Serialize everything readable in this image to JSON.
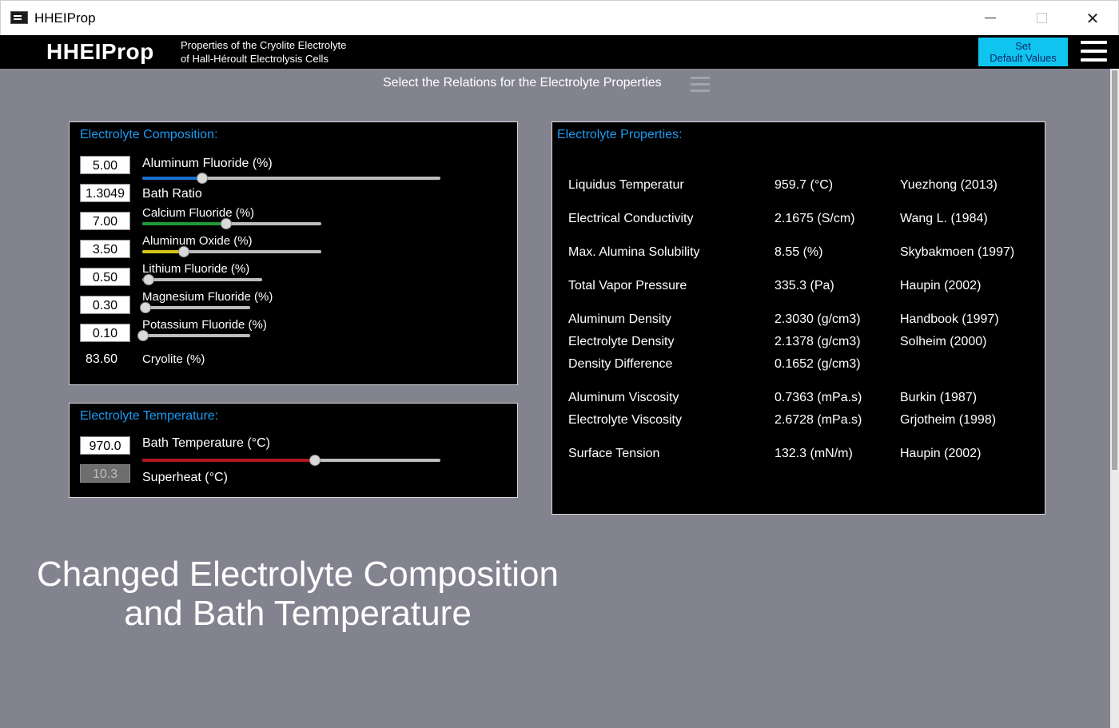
{
  "window": {
    "title": "HHEIProp"
  },
  "appbar": {
    "name": "HHEIProp",
    "subtitle_line1": "Properties of the Cryolite Electrolyte",
    "subtitle_line2": "of Hall-Héroult Electrolysis Cells",
    "default_btn_line1": "Set",
    "default_btn_line2": "Default Values"
  },
  "relations": {
    "label": "Select the Relations for the Electrolyte Properties"
  },
  "composition": {
    "title": "Electrolyte Composition:",
    "rows": [
      {
        "value": "5.00",
        "label": "Aluminum Fluoride (%)",
        "level": 0.2
      },
      {
        "value": "1.3049",
        "label": "Bath Ratio"
      },
      {
        "value": "7.00",
        "label": "Calcium Fluoride (%)",
        "level": 0.47
      },
      {
        "value": "3.50",
        "label": "Aluminum Oxide (%)",
        "level": 0.23
      },
      {
        "value": "0.50",
        "label": "Lithium Fluoride (%)",
        "level": 0.05
      },
      {
        "value": "0.30",
        "label": "Magnesium Fluoride (%)",
        "level": 0.03
      },
      {
        "value": "0.10",
        "label": "Potassium Fluoride (%)",
        "level": 0.01
      },
      {
        "value": "83.60",
        "label": "Cryolite (%)"
      }
    ],
    "colors": {
      "alf3": "#1a6fd1",
      "caf2": "#1f9a3a",
      "al2o3": "#d6c51c"
    }
  },
  "temperature": {
    "title": "Electrolyte Temperature:",
    "bath_value": "970.0",
    "bath_label": "Bath Temperature (°C)",
    "bath_level": 0.58,
    "superheat_value": "10.3",
    "superheat_label": "Superheat (°C)",
    "color": "#b0161b"
  },
  "properties": {
    "title": "Electrolyte Properties:",
    "rows": [
      {
        "name": "Liquidus Temperatur",
        "value": "959.7  (°C)",
        "ref": "Yuezhong (2013)"
      },
      {
        "name": "Electrical Conductivity",
        "value": "2.1675 (S/cm)",
        "ref": "Wang L. (1984)"
      },
      {
        "name": "Max. Alumina Solubility",
        "value": "8.55  (%)",
        "ref": "Skybakmoen (1997)"
      },
      {
        "name": "Total Vapor Pressure",
        "value": "335.3  (Pa)",
        "ref": "Haupin (2002)"
      },
      {
        "name": "Aluminum Density",
        "value": "2.3030 (g/cm3)",
        "ref": "Handbook (1997)"
      },
      {
        "name": "Electrolyte Density",
        "value": "2.1378 (g/cm3)",
        "ref": "Solheim (2000)"
      },
      {
        "name": "Density Difference",
        "value": "0.1652 (g/cm3)",
        "ref": ""
      },
      {
        "name": "Aluminum Viscosity",
        "value": "0.7363 (mPa.s)",
        "ref": "Burkin (1987)"
      },
      {
        "name": "Electrolyte Viscosity",
        "value": "2.6728 (mPa.s)",
        "ref": "Grjotheim (1998)"
      },
      {
        "name": "Surface Tension",
        "value": "132.3  (mN/m)",
        "ref": "Haupin (2002)"
      }
    ]
  },
  "caption": {
    "line1": "Changed Electrolyte Composition",
    "line2": "and Bath Temperature"
  }
}
